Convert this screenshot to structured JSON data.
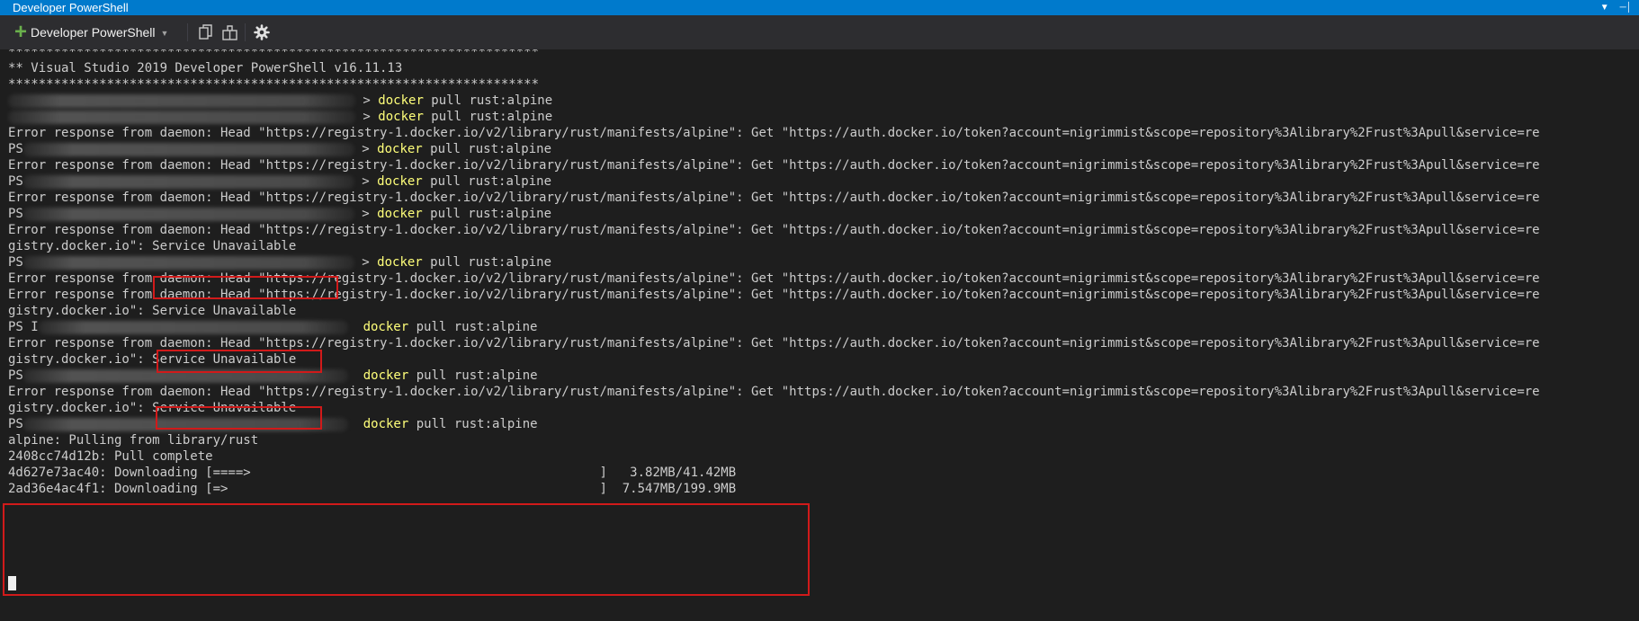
{
  "window": {
    "title": "Developer PowerShell"
  },
  "toolbar": {
    "new_terminal_label": "Developer PowerShell",
    "icons": {
      "add": "plus-icon",
      "dropdown": "chevron-down-icon",
      "copy": "copy-icon",
      "split": "split-icon",
      "settings": "gear-icon"
    }
  },
  "colors": {
    "titlebar": "#007acc",
    "toolbar": "#2d2d30",
    "terminal_bg": "#1e1e1e",
    "text": "#cccccc",
    "command": "#ffff7a",
    "highlight": "#d11a1a"
  },
  "terminal": {
    "lines": [
      {
        "text": "**********************************************************************"
      },
      {
        "text": "** Visual Studio 2019 Developer PowerShell v16.11.13"
      },
      {
        "text": "**********************************************************************"
      },
      {
        "prefix": "",
        "cmd": "docker",
        "arg": " pull rust:alpine"
      },
      {
        "prefix": "",
        "cmd": "docker",
        "arg": " pull rust:alpine"
      },
      {
        "text": "Error response from daemon: Head \"https://registry-1.docker.io/v2/library/rust/manifests/alpine\": Get \"https://auth.docker.io/token?account=nigrimmist&scope=repository%3Alibrary%2Frust%3Apull&service=re"
      },
      {
        "prefix": "PS",
        "cmd": "docker",
        "arg": " pull rust:alpine"
      },
      {
        "text": "Error response from daemon: Head \"https://registry-1.docker.io/v2/library/rust/manifests/alpine\": Get \"https://auth.docker.io/token?account=nigrimmist&scope=repository%3Alibrary%2Frust%3Apull&service=re"
      },
      {
        "prefix": "PS",
        "cmd": "docker",
        "arg": " pull rust:alpine"
      },
      {
        "text": "Error response from daemon: Head \"https://registry-1.docker.io/v2/library/rust/manifests/alpine\": Get \"https://auth.docker.io/token?account=nigrimmist&scope=repository%3Alibrary%2Frust%3Apull&service=re"
      },
      {
        "prefix": "PS",
        "cmd": "docker",
        "arg": " pull rust:alpine"
      },
      {
        "text": "Error response from daemon: Head \"https://registry-1.docker.io/v2/library/rust/manifests/alpine\": Get \"https://auth.docker.io/token?account=nigrimmist&scope=repository%3Alibrary%2Frust%3Apull&service=re"
      },
      {
        "text": "gistry.docker.io\": Service Unavailable"
      },
      {
        "prefix": "PS",
        "cmd": "docker",
        "arg": " pull rust:alpine"
      },
      {
        "text": "Error response from daemon: Head \"https://registry-1.docker.io/v2/library/rust/manifests/alpine\": Get \"https://auth.docker.io/token?account=nigrimmist&scope=repository%3Alibrary%2Frust%3Apull&service=re"
      },
      {
        "text": "Error response from daemon: Head \"https://registry-1.docker.io/v2/library/rust/manifests/alpine\": Get \"https://auth.docker.io/token?account=nigrimmist&scope=repository%3Alibrary%2Frust%3Apull&service=re"
      },
      {
        "text": "gistry.docker.io\": Service Unavailable"
      },
      {
        "prefix": "PS I",
        "cmd": "docker",
        "arg": " pull rust:alpine"
      },
      {
        "text": "Error response from daemon: Head \"https://registry-1.docker.io/v2/library/rust/manifests/alpine\": Get \"https://auth.docker.io/token?account=nigrimmist&scope=repository%3Alibrary%2Frust%3Apull&service=re"
      },
      {
        "text": "gistry.docker.io\": Service Unavailable"
      },
      {
        "prefix": "PS",
        "cmd": "docker",
        "arg": " pull rust:alpine"
      },
      {
        "text": "Error response from daemon: Head \"https://registry-1.docker.io/v2/library/rust/manifests/alpine\": Get \"https://auth.docker.io/token?account=nigrimmist&scope=repository%3Alibrary%2Frust%3Apull&service=re"
      },
      {
        "text": "gistry.docker.io\": Service Unavailable"
      },
      {
        "prefix": "PS",
        "cmd": "docker",
        "arg": " pull rust:alpine"
      },
      {
        "text": "alpine: Pulling from library/rust"
      },
      {
        "text": "2408cc74d12b: Pull complete"
      },
      {
        "text": "4d627e73ac40: Downloading [====>                                              ]   3.82MB/41.42MB"
      },
      {
        "text": "2ad36e4ac4f1: Downloading [=>                                                 ]  7.547MB/199.9MB"
      }
    ]
  }
}
